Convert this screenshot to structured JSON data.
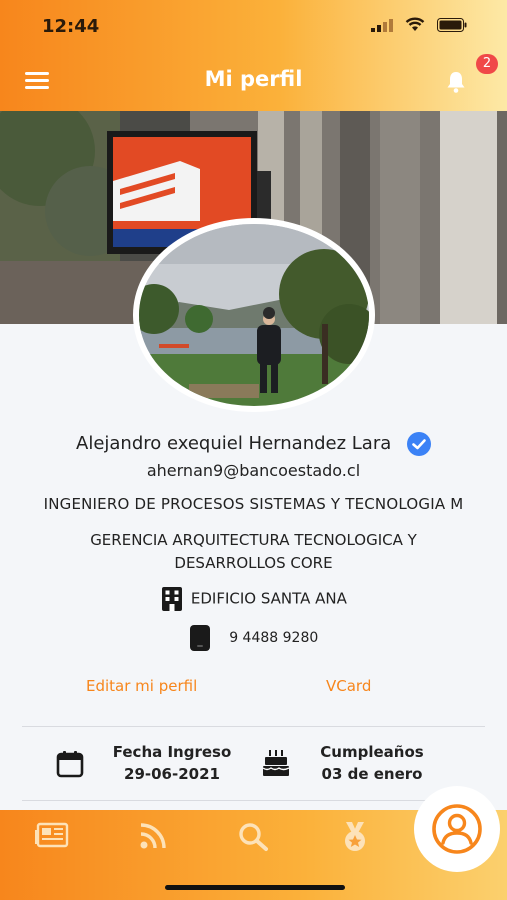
{
  "status_bar": {
    "time": "12:44"
  },
  "header": {
    "title": "Mi perfil",
    "notification_count": "2"
  },
  "profile": {
    "name": "Alejandro exequiel Hernandez Lara",
    "email": "ahernan9@bancoestado.cl",
    "role": "INGENIERO DE PROCESOS SISTEMAS Y TECNOLOGIA M",
    "department": "GERENCIA ARQUITECTURA TECNOLOGICA Y DESARROLLOS CORE",
    "building": "EDIFICIO SANTA ANA",
    "phone": "9 4488 9280"
  },
  "actions": {
    "edit_label": "Editar mi perfil",
    "vcard_label": "VCard"
  },
  "info": {
    "ingreso_label": "Fecha Ingreso",
    "ingreso_value": "29-06-2021",
    "birthday_label": "Cumpleaños",
    "birthday_value": "03 de enero"
  },
  "bottom_nav": {
    "items": [
      "news-icon",
      "rss-icon",
      "search-icon",
      "medal-icon",
      "profile-icon"
    ],
    "active": "profile-icon"
  },
  "colors": {
    "accent": "#f7861c",
    "accent_light": "#fbb13a",
    "verified": "#3b82f6",
    "badge": "#f04848"
  }
}
